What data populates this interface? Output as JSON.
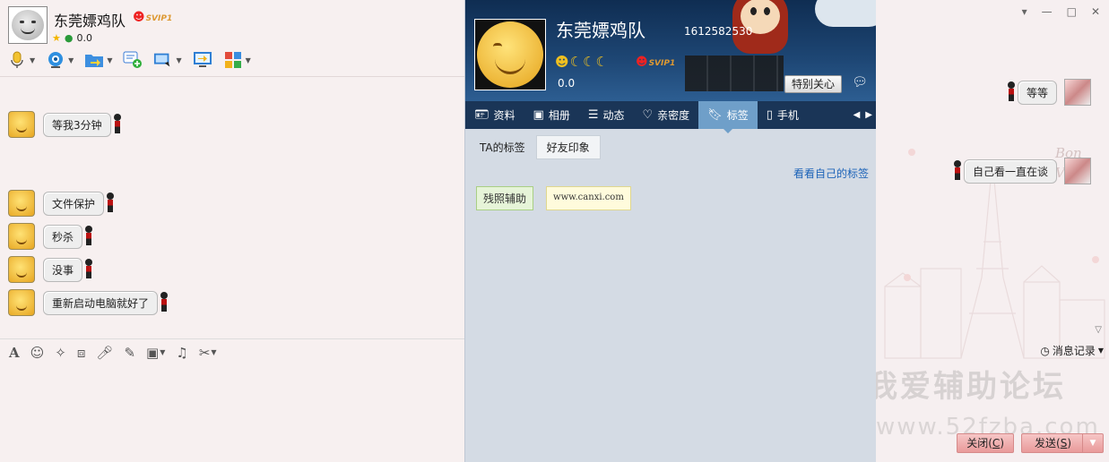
{
  "contact": {
    "name": "东莞嫖鸡队",
    "badge": "SVIP1",
    "score": "0.0",
    "qq_number": "1612582530"
  },
  "toolbar": {
    "icons": [
      "microphone-icon",
      "webcam-icon",
      "file-transfer-icon",
      "add-chat-icon",
      "remote-desktop-icon",
      "screen-share-icon",
      "apps-grid-icon"
    ]
  },
  "messages_left": [
    {
      "text": "等我3分钟"
    },
    {
      "text": "文件保护"
    },
    {
      "text": "秒杀"
    },
    {
      "text": "没事"
    },
    {
      "text": "重新启动电脑就好了"
    }
  ],
  "profile": {
    "special_button": "特别关心",
    "tabs": [
      {
        "icon": "id-card-icon",
        "label": "资料"
      },
      {
        "icon": "photo-album-icon",
        "label": "相册"
      },
      {
        "icon": "feed-list-icon",
        "label": "动态"
      },
      {
        "icon": "heart-icon",
        "label": "亲密度"
      },
      {
        "icon": "bookmark-icon",
        "label": "标签"
      },
      {
        "icon": "phone-icon",
        "label": "手机"
      }
    ],
    "active_tab": "标签",
    "subtabs": {
      "ta_tags": "TA的标签",
      "friend_impression": "好友印象"
    },
    "see_own_tags": "看看自己的标签",
    "tags": [
      "残照辅助",
      "www.canxi.com"
    ]
  },
  "messages_right": [
    {
      "text": "等等"
    },
    {
      "text": "自己看一直在谈"
    }
  ],
  "right": {
    "history_label": "消息记录",
    "watermark_cn": "我爱辅助论坛",
    "watermark_url": "www.52fzba.com",
    "cursive": "Bon\nVoy",
    "close_prefix": "关闭(",
    "close_key": "C",
    "close_suffix": ")",
    "send_prefix": "发送(",
    "send_key": "S",
    "send_suffix": ")"
  },
  "colors": {
    "banner": "#1e4775",
    "tabbar": "#1a3557",
    "active_tab": "#6f9fc9",
    "link": "#1c63b8",
    "send_button": "#e99a9a"
  }
}
